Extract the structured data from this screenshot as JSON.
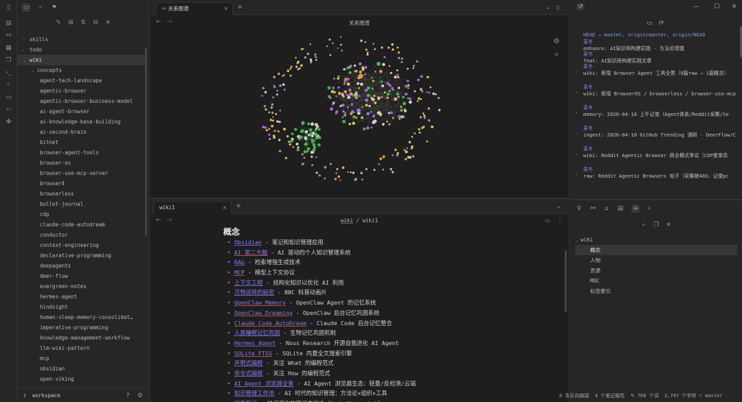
{
  "ribbon": {
    "icons": [
      "sidebar-toggle-icon",
      "files-icon",
      "graph-icon",
      "calendar-icon",
      "copy-icon",
      "terminal-icon",
      "git-icon",
      "page-icon",
      "code-icon",
      "puzzle-icon"
    ]
  },
  "sidebar": {
    "tree": [
      {
        "label": "skills",
        "chevron": "›",
        "indent": 0
      },
      {
        "label": "todo",
        "chevron": "›",
        "indent": 0
      },
      {
        "label": "wiki",
        "chevron": "⌄",
        "indent": 0,
        "selected": true
      },
      {
        "label": "concepts",
        "chevron": "⌄",
        "indent": 1
      },
      {
        "label": "agent-tech-landscape",
        "indent": 2
      },
      {
        "label": "agentic-browser",
        "indent": 2
      },
      {
        "label": "agentic-browser-business-model",
        "indent": 2
      },
      {
        "label": "ai-agent-browser",
        "indent": 2
      },
      {
        "label": "ai-knowledge-base-building",
        "indent": 2
      },
      {
        "label": "ai-second-brain",
        "indent": 2
      },
      {
        "label": "bitnet",
        "indent": 2
      },
      {
        "label": "browser-agent-tools",
        "indent": 2
      },
      {
        "label": "browser-os",
        "indent": 2
      },
      {
        "label": "browser-use-mcp-server",
        "indent": 2
      },
      {
        "label": "browser4",
        "indent": 2
      },
      {
        "label": "browserless",
        "indent": 2
      },
      {
        "label": "bullet-journal",
        "indent": 2
      },
      {
        "label": "cdp",
        "indent": 2
      },
      {
        "label": "claude-code-autodream",
        "indent": 2
      },
      {
        "label": "conductor",
        "indent": 2
      },
      {
        "label": "context-engineering",
        "indent": 2
      },
      {
        "label": "declarative-programming",
        "indent": 2
      },
      {
        "label": "deepagents",
        "indent": 2
      },
      {
        "label": "deer-flow",
        "indent": 2
      },
      {
        "label": "evergreen-notes",
        "indent": 2
      },
      {
        "label": "hermes-agent",
        "indent": 2
      },
      {
        "label": "hindsight",
        "indent": 2
      },
      {
        "label": "human-sleep-memory-consolidat…",
        "indent": 2
      },
      {
        "label": "imperative-programming",
        "indent": 2
      },
      {
        "label": "knowledge-management-workflow",
        "indent": 2
      },
      {
        "label": "llm-wiki-pattern",
        "indent": 2
      },
      {
        "label": "mcp",
        "indent": 2
      },
      {
        "label": "obsidian",
        "indent": 2
      },
      {
        "label": "open-viking",
        "indent": 2
      }
    ],
    "vault": "workspace"
  },
  "top_tab": {
    "label": "关系图谱",
    "icon": "graph-icon"
  },
  "graph_title": "关系图谱",
  "bottom_tab": {
    "label": "wiki1"
  },
  "breadcrumb": {
    "parent": "wiki",
    "sep": " / ",
    "current": "wiki1"
  },
  "doc": {
    "heading": "概念",
    "items": [
      {
        "link": "Obsidian",
        "rest": " - 笔记和知识管理应用"
      },
      {
        "link": "AI 第二大脑",
        "rest": " - AI 驱动的个人知识管理系统",
        "red": true
      },
      {
        "link": "RAG",
        "rest": " - 检索增强生成技术"
      },
      {
        "link": "MCP",
        "rest": " - 模型上下文协议",
        "red": true
      },
      {
        "link": "上下文工程",
        "rest": " - 结构化知识以优化 AI 利用"
      },
      {
        "link": "万物运转的秘密",
        "rest": " - BBC 科普动画片"
      },
      {
        "link": "OpenClaw Memory",
        "rest": " - OpenClaw Agent 的记忆系统",
        "red": true
      },
      {
        "link": "OpenClaw Dreaming",
        "rest": " - OpenClaw 后台记忆巩固系统",
        "red": true
      },
      {
        "link": "Claude Code AutoDream",
        "rest": " - Claude Code 后台记忆整合",
        "red": true
      },
      {
        "link": "人类睡眠记忆巩固",
        "rest": " - 生物记忆巩固机制"
      },
      {
        "link": "Hermes Agent",
        "rest": " - Nous Research 开源自我进化 AI Agent"
      },
      {
        "link": "SQLite FTS5",
        "rest": " - SQLite 内置全文搜索引擎",
        "red": true
      },
      {
        "link": "声明式编程",
        "rest": " - 关注 What 的编程范式"
      },
      {
        "link": "命令式编程",
        "rest": " - 关注 How 的编程范式"
      },
      {
        "link": "AI Agent 浏览器全景",
        "rest": " - AI Agent 浏览器生态：轻量/反检测/云端"
      },
      {
        "link": "知识管理工作流",
        "rest": " - AI 时代的知识管理：方法论×组织×工具"
      },
      {
        "link": "常青笔记",
        "rest": " - 持续演化的笔记方法论（Andy Matuschak）"
      }
    ]
  },
  "git": {
    "head": "HEAD → master, origin/master, origin/HEAD",
    "commits": [
      {
        "author": "麦冬",
        "msg": "enhance: AI知识库构建实践 - 方法论增强"
      },
      {
        "author": "麦冬",
        "msg": "feat: AI知识库构建实践文章"
      },
      {
        "author": "麦冬",
        "msg": "wiki: 新增 Browser Agent 工具全景（9篇raw → 1篇概念）"
      },
      {
        "author": "麦冬",
        "msg": "wiki: 新增 BrowserOS / browserless / browser-use-mcp"
      },
      {
        "author": "麦冬",
        "msg": "memory: 2026-04-10 上午记录（Agent体系/Reddit采集/Se"
      },
      {
        "author": "麦冬",
        "msg": "ingest: 2026-04-10 GitHub Trending 调研 - DeerFlow/C"
      },
      {
        "author": "麦冬",
        "msg": "wiki: Reddit Agentic Browser 商业模式争议（CDP登录态"
      },
      {
        "author": "麦冬",
        "msg": "raw: Reddit Agentic Browsers 帖子（采集被403，记录pc"
      }
    ]
  },
  "outline": {
    "root": "wiki",
    "items": [
      {
        "label": "概念",
        "selected": true
      },
      {
        "label": "人物"
      },
      {
        "label": "资源"
      },
      {
        "label": "MOC"
      },
      {
        "label": "标签索引"
      }
    ]
  },
  "statusbar": {
    "backlinks": "0 条反向链接",
    "props": "4 个笔记属性",
    "words": "768 个词",
    "chars": "2,747 个字符",
    "branch": "master"
  },
  "colors": {
    "accent": "#8a7cf0",
    "background": "#1e1e1e",
    "panel": "#262626",
    "node_green": "#4caf50",
    "node_purple": "#a66ad6",
    "node_yellow": "#d7c45a",
    "node_orange": "#e0a040"
  }
}
